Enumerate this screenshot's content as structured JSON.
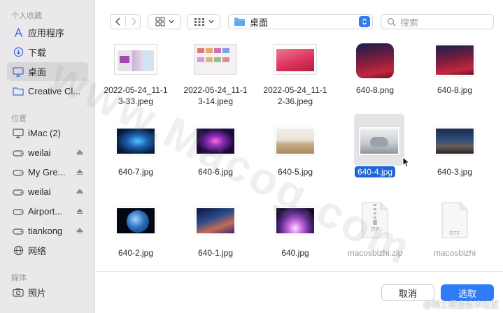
{
  "sidebar": {
    "favorites_header": "个人收藏",
    "locations_header": "位置",
    "media_header": "媒体",
    "favorites": [
      {
        "label": "应用程序",
        "icon": "applications-icon"
      },
      {
        "label": "下载",
        "icon": "download-icon"
      },
      {
        "label": "桌面",
        "icon": "desktop-icon",
        "selected": true
      },
      {
        "label": "Creative Cl...",
        "icon": "folder-icon"
      }
    ],
    "locations": [
      {
        "label": "iMac (2)",
        "icon": "computer-icon"
      },
      {
        "label": "weilai",
        "icon": "disk-icon",
        "eject": true
      },
      {
        "label": "My Gre...",
        "icon": "disk-icon",
        "eject": true
      },
      {
        "label": "weilai",
        "icon": "disk-icon",
        "eject": true
      },
      {
        "label": "Airport...",
        "icon": "disk-icon",
        "eject": true
      },
      {
        "label": "tiankong",
        "icon": "disk-icon",
        "eject": true
      },
      {
        "label": "网络",
        "icon": "network-icon"
      }
    ],
    "media": [
      {
        "label": "照片",
        "icon": "photos-icon"
      }
    ]
  },
  "toolbar": {
    "location": "桌面",
    "search_placeholder": "搜索"
  },
  "files": [
    {
      "name": "2022-05-24_11-1\n3-33.jpeg"
    },
    {
      "name": "2022-05-24_11-1\n3-14.jpeg"
    },
    {
      "name": "2022-05-24_11-1\n2-36.jpeg"
    },
    {
      "name": "640-8.png"
    },
    {
      "name": "640-8.jpg"
    },
    {
      "name": "640-7.jpg"
    },
    {
      "name": "640-6.jpg"
    },
    {
      "name": "640-5.jpg"
    },
    {
      "name": "640-4.jpg",
      "selected": true
    },
    {
      "name": "640-3.jpg"
    },
    {
      "name": "640-2.jpg"
    },
    {
      "name": "640-1.jpg"
    },
    {
      "name": "640.jpg"
    },
    {
      "name": "macosbizhi.zip",
      "type_label": "ZIP",
      "dimmed": true
    },
    {
      "name": "macosbizhi",
      "type_label": "RTF",
      "dimmed": true
    }
  ],
  "buttons": {
    "cancel": "取消",
    "open": "选取"
  },
  "watermark": "www.Macog.com",
  "credit": "@稀土掘金技术社区",
  "colors": {
    "accent": "#2f7cf6",
    "selection": "#1f64d8",
    "sidebar_bg": "#ebe8eb"
  }
}
